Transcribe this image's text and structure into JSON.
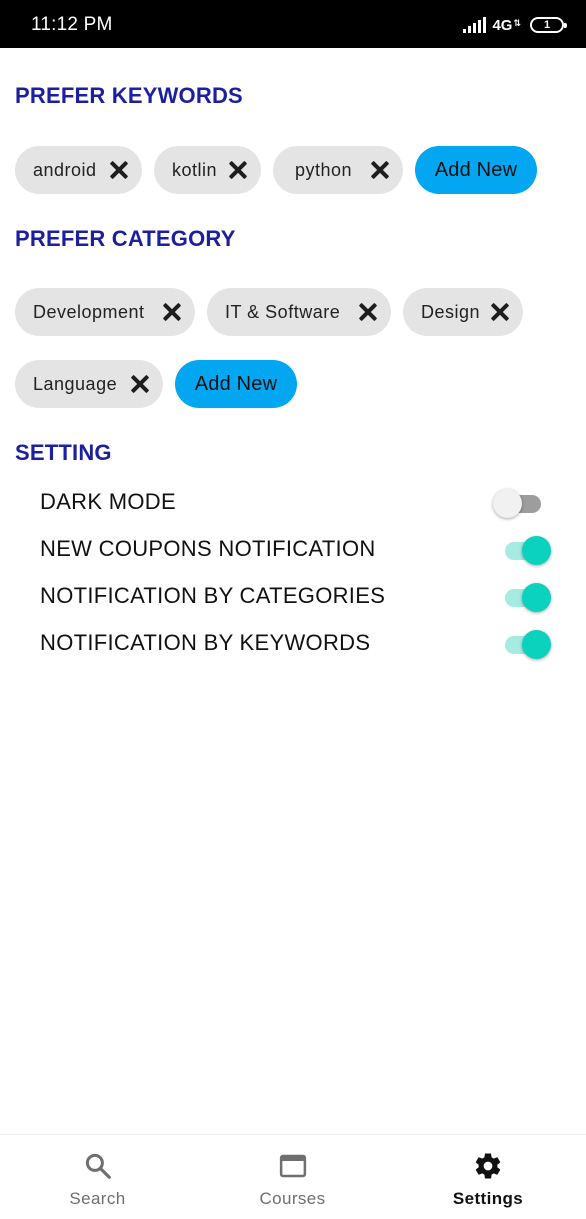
{
  "status_bar": {
    "time": "11:12 PM",
    "network": "4G",
    "battery": "1"
  },
  "keywords": {
    "title": "PREFER KEYWORDS",
    "chips": [
      "android",
      "kotlin",
      "python"
    ],
    "add_label": "Add New"
  },
  "category": {
    "title": "PREFER CATEGORY",
    "chips": [
      "Development",
      "IT & Software",
      "Design",
      "Language"
    ],
    "add_label": "Add New"
  },
  "setting": {
    "title": "SETTING",
    "items": [
      {
        "label": "DARK MODE",
        "enabled": false
      },
      {
        "label": "NEW COUPONS NOTIFICATION",
        "enabled": true
      },
      {
        "label": "NOTIFICATION BY CATEGORIES",
        "enabled": true
      },
      {
        "label": "NOTIFICATION BY KEYWORDS",
        "enabled": true
      }
    ]
  },
  "bottom_nav": {
    "items": [
      {
        "label": "Search",
        "icon": "search-icon"
      },
      {
        "label": "Courses",
        "icon": "window-icon"
      },
      {
        "label": "Settings",
        "icon": "gear-icon",
        "active": true
      }
    ]
  },
  "colors": {
    "heading": "#1b1fa0",
    "accent_blue": "#03a6f0",
    "switch_on": "#0ad2bd",
    "chip_bg": "#e4e4e4"
  }
}
